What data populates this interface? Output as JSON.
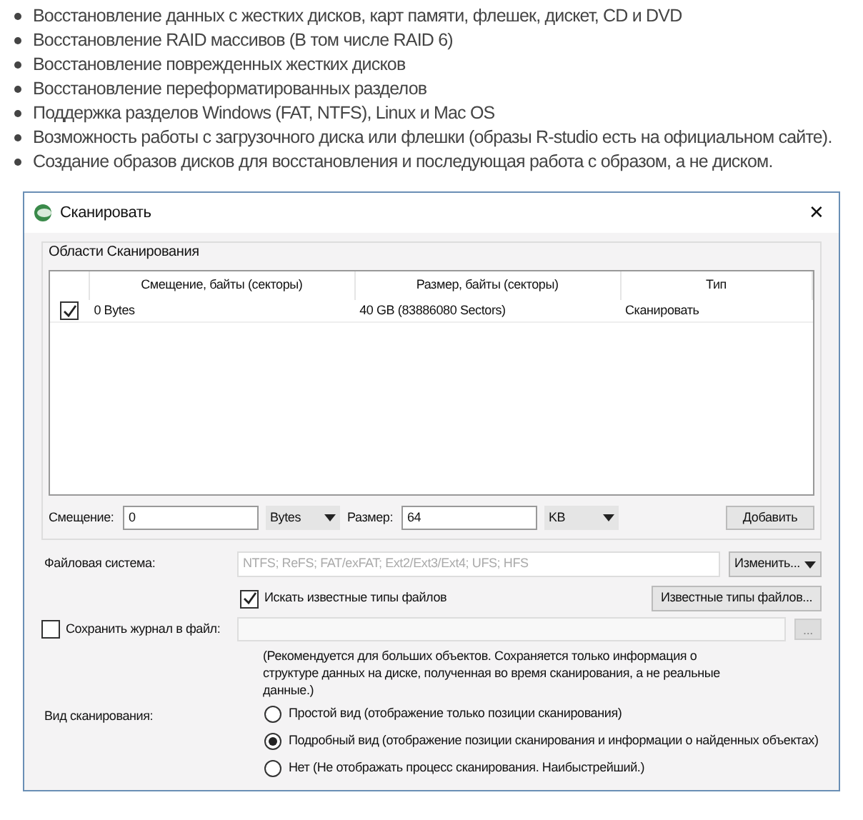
{
  "bullets": [
    "Восстановление данных с жестких дисков, карт памяти, флешек, дискет, CD и DVD",
    "Восстановление RAID массивов (В том числе RAID 6)",
    "Восстановление поврежденных жестких дисков",
    "Восстановление переформатированных разделов",
    "Поддержка разделов Windows (FAT, NTFS), Linux и Mac OS",
    "Возможность работы с загрузочного диска или флешки (образы R-studio есть на официальном сайте).",
    "Создание образов дисков для восстановления и последующая работа с образом, а не диском."
  ],
  "dialog": {
    "title": "Сканировать",
    "close": "✕",
    "group_title": "Области Сканирования",
    "table": {
      "columns": [
        "Смещение, байты (секторы)",
        "Размер, байты (секторы)",
        "Тип"
      ],
      "rows": [
        {
          "checked": true,
          "offset": "0 Bytes",
          "size": "40 GB (83886080 Sectors)",
          "type": "Сканировать"
        }
      ]
    },
    "offset_label": "Смещение:",
    "offset_value": "0",
    "offset_unit": "Bytes",
    "size_label": "Размер:",
    "size_value": "64",
    "size_unit": "KB",
    "add_button": "Добавить",
    "fs_label": "Файловая система:",
    "fs_value": "NTFS; ReFS; FAT/exFAT; Ext2/Ext3/Ext4; UFS; HFS",
    "change_button": "Изменить...",
    "search_known": {
      "label": "Искать известные типы файлов",
      "checked": true
    },
    "known_types_button": "Известные типы файлов...",
    "save_log": {
      "label": "Сохранить журнал в файл:",
      "checked": false
    },
    "browse_button": "...",
    "note": "(Рекомендуется для больших объектов. Сохраняется только информация о структуре данных на диске, полученная во время сканирования, а не реальные данные.)",
    "scan_view_label": "Вид сканирования:",
    "scan_views": [
      {
        "label": "Простой вид (отображение только позиции сканирования)",
        "selected": false
      },
      {
        "label": "Подробный вид (отображение позиции сканирования и информации о найденных объектах)",
        "selected": true
      },
      {
        "label": "Нет (Не отображать процесс сканирования. Наибыстрейший.)",
        "selected": false
      }
    ]
  }
}
